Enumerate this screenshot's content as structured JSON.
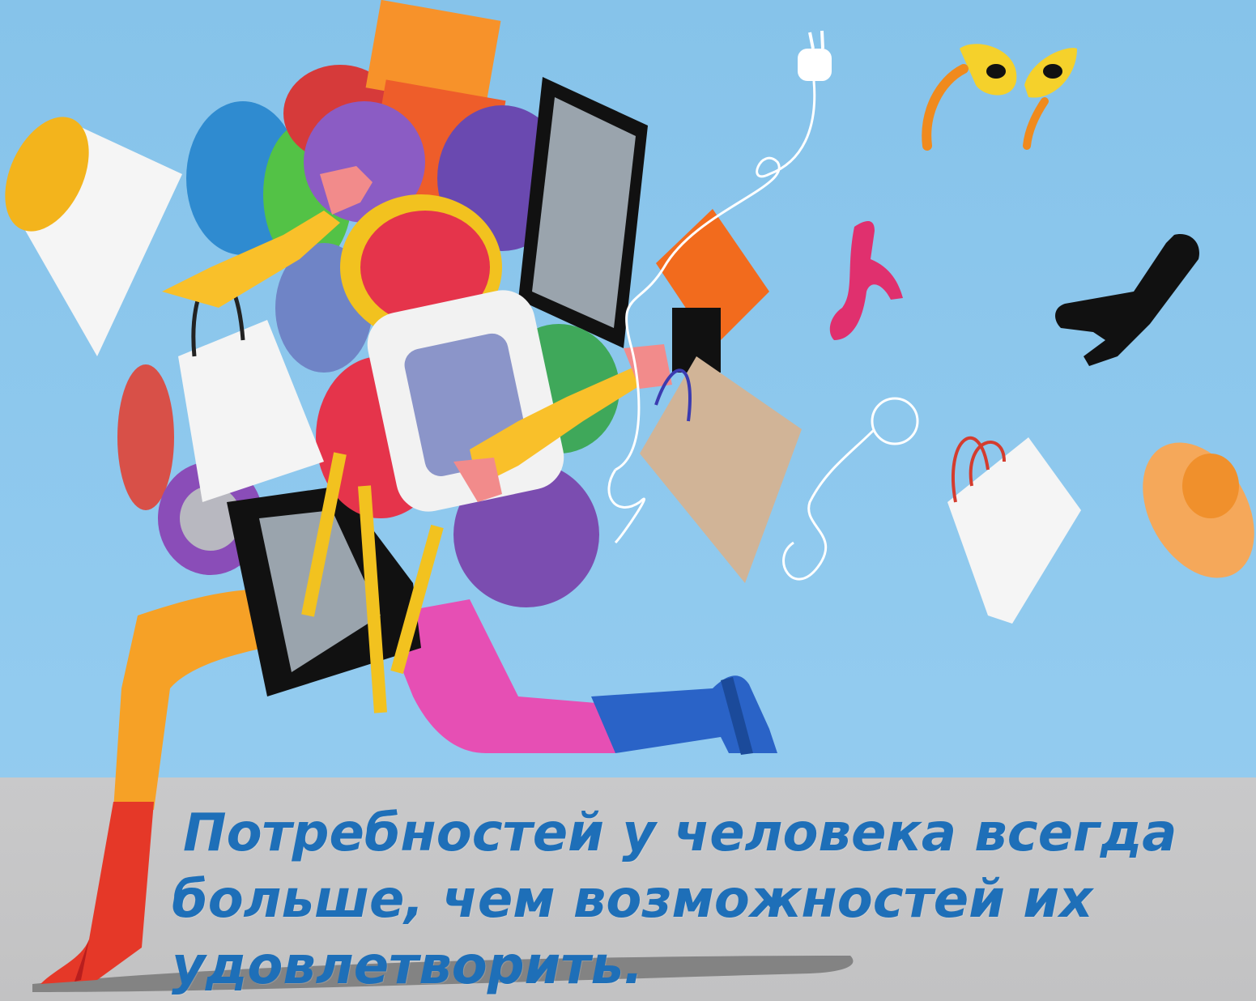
{
  "caption": {
    "line1": "Потребностей у человека всегда",
    "line2": "больше, чем возможностей их",
    "line3": "удовлетворить."
  },
  "colors": {
    "sky": "#8ec8ec",
    "floor": "#c6c6c7",
    "caption_text": "#1e6fb8"
  },
  "illustration": {
    "icons": [
      "running-shopper-figure",
      "lampshade-icon",
      "power-plug-icon",
      "sunglasses-icon",
      "high-heel-shoe-icon",
      "boot-icon",
      "shopping-bag-icon",
      "hat-icon",
      "tv-screen-icon",
      "chair-icon"
    ]
  }
}
